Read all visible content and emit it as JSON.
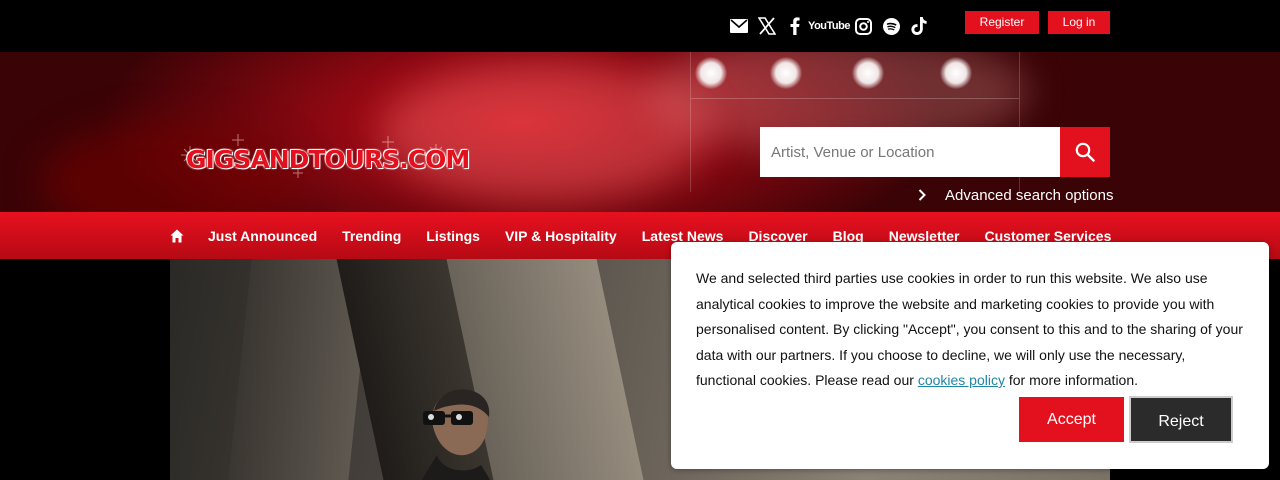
{
  "top": {
    "social_icons": [
      "mail-icon",
      "x-icon",
      "facebook-icon",
      "youtube-icon",
      "instagram-icon",
      "spotify-icon",
      "tiktok-icon"
    ],
    "youtube_label": "YouTube",
    "register_label": "Register",
    "login_label": "Log in"
  },
  "brand": {
    "logo_text": "GIGSANDTOURS.COM",
    "accent": "#e3101e"
  },
  "search": {
    "placeholder": "Artist, Venue or Location",
    "advanced_label": "Advanced search options"
  },
  "nav": {
    "items": [
      "Just Announced",
      "Trending",
      "Listings",
      "VIP & Hospitality",
      "Latest News",
      "Discover",
      "Blog",
      "Newsletter",
      "Customer Services"
    ]
  },
  "cookie": {
    "text_before": "We and selected third parties use cookies in order to run this website. We also use analytical cookies to improve the website and marketing cookies to provide you with personalised content. By clicking \"Accept\", you consent to this and to the sharing of your data with our partners. If you choose to decline, we will only use the necessary, functional cookies. Please read our ",
    "link_text": "cookies policy",
    "text_after": " for more information.",
    "accept_label": "Accept",
    "reject_label": "Reject"
  }
}
